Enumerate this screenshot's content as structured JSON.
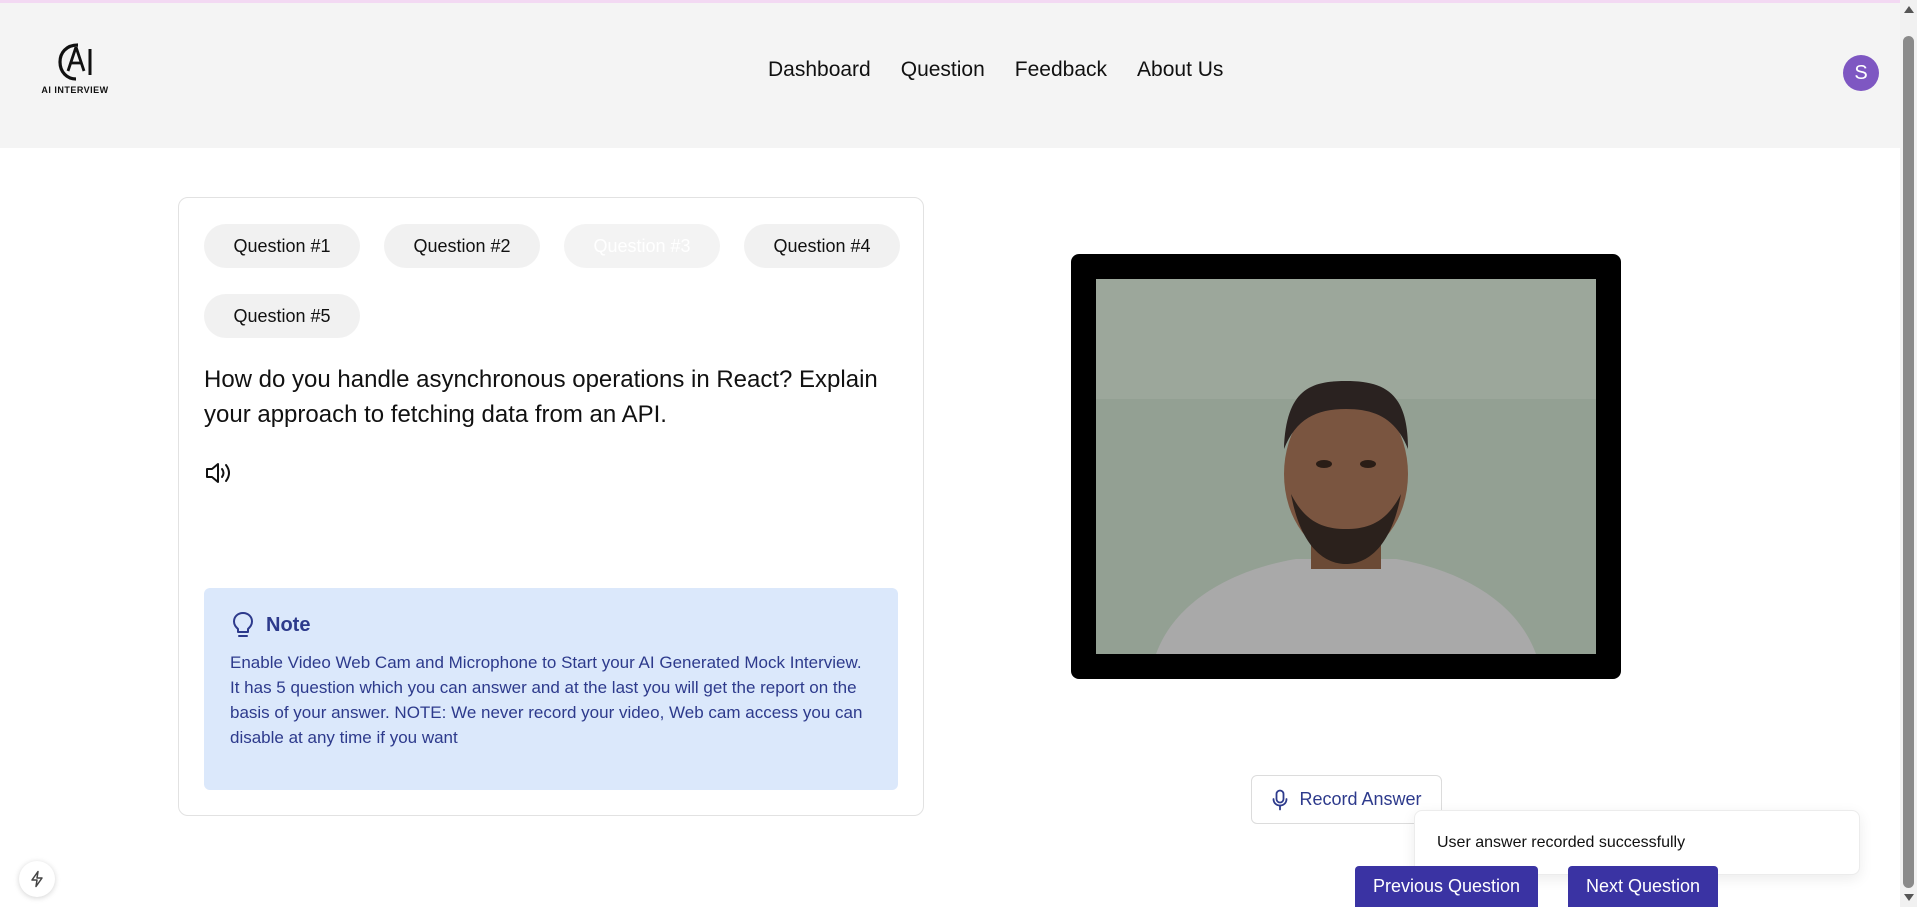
{
  "header": {
    "logo_text": "AI INTERVIEW",
    "nav": [
      "Dashboard",
      "Question",
      "Feedback",
      "About Us"
    ],
    "avatar_initial": "S"
  },
  "questions": {
    "tabs": [
      "Question #1",
      "Question #2",
      "Question #3",
      "Question #4",
      "Question #5"
    ],
    "active_tab": "Question #3",
    "current_text": "How do you handle asynchronous operations in React? Explain your approach to fetching data from an API."
  },
  "note": {
    "title": "Note",
    "body": "Enable Video Web Cam and Microphone to Start your AI Generated Mock Interview. It has 5 question which you can answer and at the last you will get the report on the basis of your answer. NOTE: We never record your video, Web cam access you can disable at any time if you want"
  },
  "record": {
    "label": "Record Answer"
  },
  "toast": {
    "message": "User answer recorded successfully"
  },
  "footer_buttons": {
    "previous": "Previous Question",
    "next": "Next Question"
  },
  "colors": {
    "primary": "#3a33a3",
    "note_bg": "#dbe8fb",
    "note_text": "#2d3a8c",
    "avatar": "#7e57c2"
  },
  "icons": {
    "speaker": "volume-icon",
    "note": "lightbulb-icon",
    "record": "microphone-icon",
    "floating": "bolt-icon"
  }
}
